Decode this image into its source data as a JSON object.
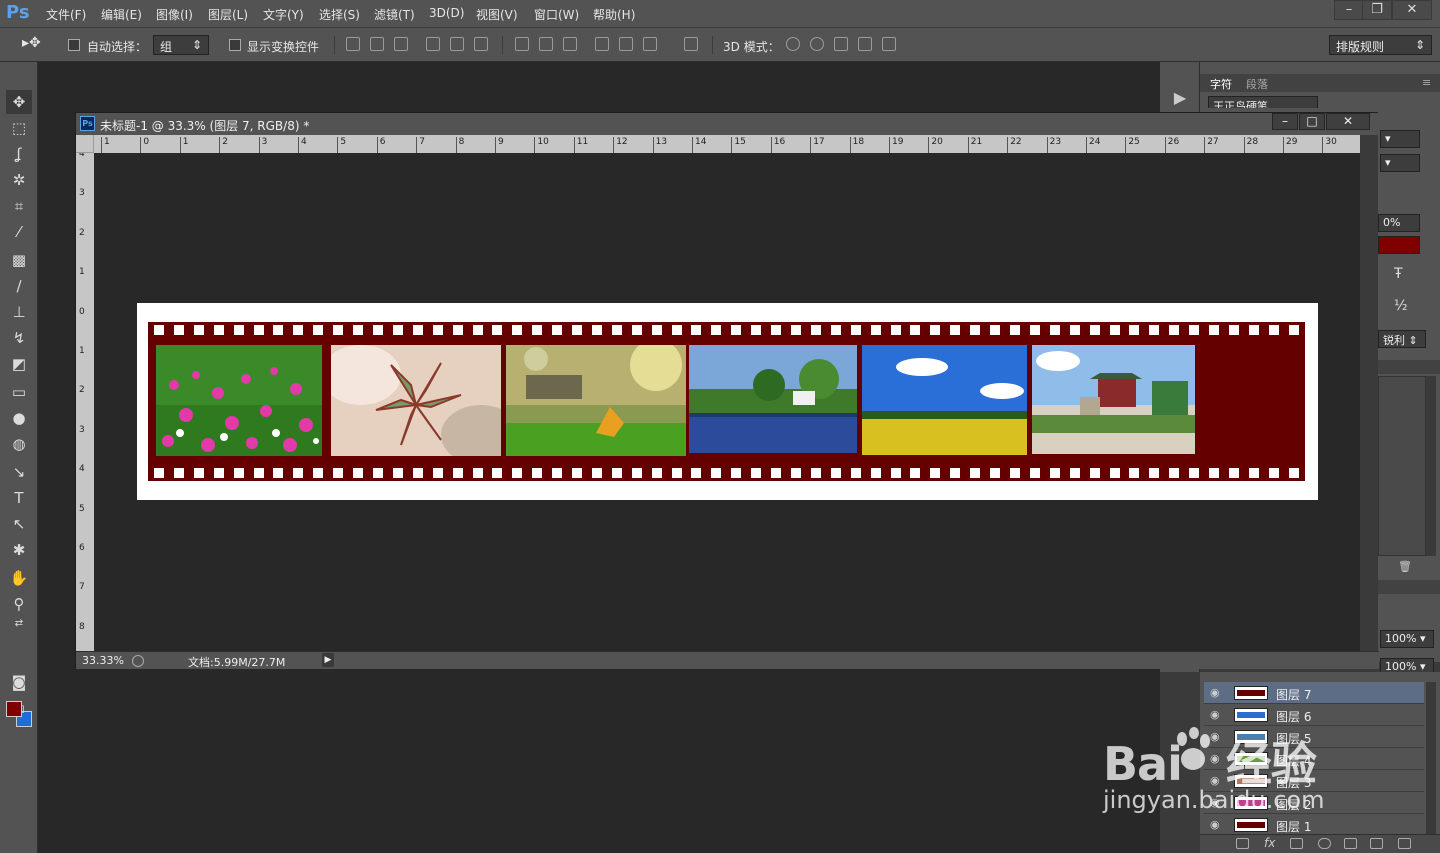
{
  "app": {
    "logo": "Ps"
  },
  "menu": [
    "文件(F)",
    "编辑(E)",
    "图像(I)",
    "图层(L)",
    "文字(Y)",
    "选择(S)",
    "滤镜(T)",
    "3D(D)",
    "视图(V)",
    "窗口(W)",
    "帮助(H)"
  ],
  "window_controls": {
    "minimize": "–",
    "restore": "❐",
    "close": "✕"
  },
  "options": {
    "auto_select_label": "自动选择：",
    "auto_select_value": "组",
    "show_transform_label": "显示变换控件",
    "mode_3d_label": "3D 模式：",
    "workspace": "排版规则"
  },
  "document": {
    "title": "未标题-1 @ 33.3% (图层 7, RGB/8) *",
    "zoom": "33.33%",
    "info": "文档:5.99M/27.7M",
    "ruler_h": [
      "1",
      "0",
      "1",
      "2",
      "3",
      "4",
      "5",
      "6",
      "7",
      "8",
      "9",
      "10",
      "11",
      "12",
      "13",
      "14",
      "15",
      "16",
      "17",
      "18",
      "19",
      "20",
      "21",
      "22",
      "23",
      "24",
      "25",
      "26",
      "27",
      "28",
      "29",
      "30"
    ],
    "ruler_v": [
      "4",
      "3",
      "2",
      "1",
      "0",
      "1",
      "2",
      "3",
      "4",
      "5",
      "6",
      "7",
      "8"
    ]
  },
  "character_panel": {
    "tabs": [
      "字符",
      "段落"
    ],
    "font": "王正鸟硬笔",
    "tracking_percent": "0%",
    "color": "#800000",
    "antialias": "锐利",
    "scale_v": "100%",
    "scale_h": "100%"
  },
  "layers": [
    {
      "name": "图层 7",
      "selected": true
    },
    {
      "name": "图层 6",
      "selected": false
    },
    {
      "name": "图层 5",
      "selected": false
    },
    {
      "name": "图层 4",
      "selected": false
    },
    {
      "name": "图层 3",
      "selected": false
    },
    {
      "name": "图层 2",
      "selected": false
    },
    {
      "name": "图层 1",
      "selected": false
    }
  ],
  "watermark": {
    "brand": "Bai",
    "brand_cn": "经验",
    "url": "jingyan.baidu.com"
  },
  "colors": {
    "foreground": "#800000",
    "background": "#1b6fd6",
    "film": "#640000"
  }
}
